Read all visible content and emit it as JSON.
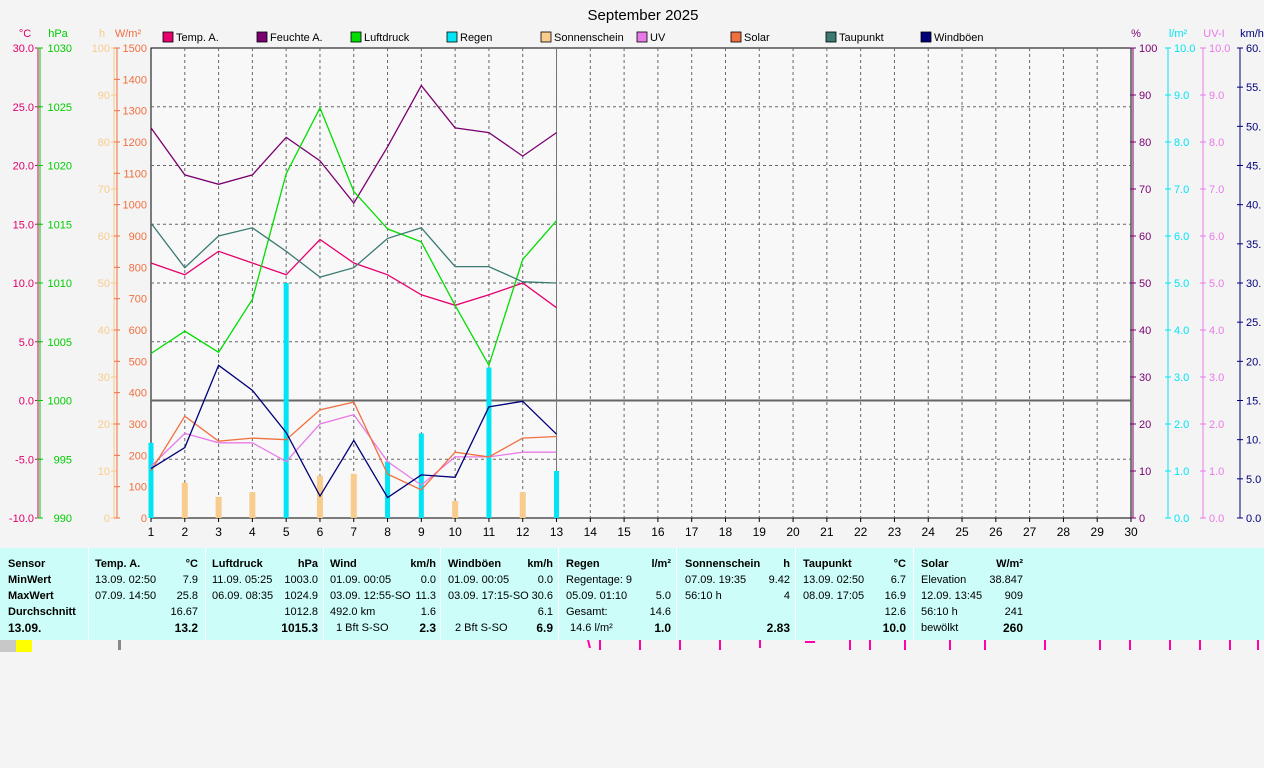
{
  "chart_data": {
    "type": "line",
    "title": "September 2025",
    "x": [
      1,
      2,
      3,
      4,
      5,
      6,
      7,
      8,
      9,
      10,
      11,
      12,
      13
    ],
    "x_ticks": [
      1,
      2,
      3,
      4,
      5,
      6,
      7,
      8,
      9,
      10,
      11,
      12,
      13,
      14,
      15,
      16,
      17,
      18,
      19,
      20,
      21,
      22,
      23,
      24,
      25,
      26,
      27,
      28,
      29,
      30
    ],
    "xlim": [
      1,
      30
    ],
    "legend": [
      "Temp. A.",
      "Feuchte A.",
      "Luftdruck",
      "Regen",
      "Sonnenschein",
      "UV",
      "Solar",
      "Taupunkt",
      "Windböen"
    ],
    "axes": {
      "temp": {
        "unit": "°C",
        "ticks": [
          "30.0",
          "25.0",
          "20.0",
          "15.0",
          "10.0",
          "5.0",
          "0.0",
          "-5.0",
          "-10.0"
        ],
        "ylim": [
          -10,
          30
        ]
      },
      "pressure": {
        "unit": "hPa",
        "ticks": [
          "1030",
          "1025",
          "1020",
          "1015",
          "1010",
          "1005",
          "1000",
          "995",
          "990"
        ],
        "ylim": [
          990,
          1030
        ]
      },
      "sunshine": {
        "unit": "h",
        "ticks": [
          "100",
          "90",
          "80",
          "70",
          "60",
          "50",
          "40",
          "30",
          "20",
          "10",
          "0"
        ],
        "ylim": [
          0,
          100
        ]
      },
      "solar": {
        "unit": "W/m²",
        "ticks": [
          "1500",
          "1400",
          "1300",
          "1200",
          "1100",
          "1000",
          "900",
          "800",
          "700",
          "600",
          "500",
          "400",
          "300",
          "200",
          "100",
          "0"
        ],
        "ylim": [
          0,
          1500
        ]
      },
      "humidity": {
        "unit": "%",
        "ticks": [
          "100",
          "90",
          "80",
          "70",
          "60",
          "50",
          "40",
          "30",
          "20",
          "10",
          "0"
        ],
        "ylim": [
          0,
          100
        ]
      },
      "rain": {
        "unit": "l/m²",
        "ticks": [
          "10.0",
          "9.0",
          "8.0",
          "7.0",
          "6.0",
          "5.0",
          "4.0",
          "3.0",
          "2.0",
          "1.0",
          "0.0"
        ],
        "ylim": [
          0,
          10
        ]
      },
      "uv": {
        "unit": "UV-I",
        "ticks": [
          "10.0",
          "9.0",
          "8.0",
          "7.0",
          "6.0",
          "5.0",
          "4.0",
          "3.0",
          "2.0",
          "1.0",
          "0.0"
        ],
        "ylim": [
          0,
          10
        ]
      },
      "wind": {
        "unit": "km/h",
        "ticks": [
          "60.",
          "55.",
          "50.",
          "45.",
          "40.",
          "35.",
          "30.",
          "25.",
          "20.",
          "15.",
          "10.",
          "5.0",
          "0.0"
        ],
        "ylim": [
          0,
          60
        ]
      }
    },
    "series": [
      {
        "name": "Temp. A.",
        "axis": "temp",
        "color": "#e6006e",
        "values": [
          11.7,
          10.7,
          12.7,
          11.7,
          10.7,
          13.7,
          11.7,
          10.7,
          9.0,
          8.1,
          9.0,
          10.0,
          7.9
        ]
      },
      {
        "name": "Feuchte A.",
        "axis": "humidity",
        "color": "#7a0070",
        "values": [
          83,
          73,
          71,
          73,
          81,
          76,
          67,
          79,
          92,
          83,
          82,
          77,
          82
        ]
      },
      {
        "name": "Luftdruck",
        "axis": "pressure",
        "color": "#00dd00",
        "values": [
          1004.0,
          1005.9,
          1004.1,
          1008.6,
          1019.3,
          1024.9,
          1017.8,
          1014.6,
          1013.5,
          1008.1,
          1003.0,
          1012.0,
          1015.3
        ]
      },
      {
        "name": "Regen",
        "axis": "rain",
        "color": "#00e5f5",
        "type": "bar",
        "values": [
          1.6,
          0,
          0,
          0.2,
          5.0,
          0.2,
          0,
          1.2,
          1.8,
          0,
          3.2,
          0.4,
          1.0
        ]
      },
      {
        "name": "Sonnenschein",
        "axis": "sunshine",
        "color": "#f8cc8c",
        "type": "bar",
        "values": [
          0,
          7.5,
          4.5,
          5.5,
          0,
          9.0,
          9.4,
          0,
          0,
          3.6,
          0,
          5.5,
          0
        ]
      },
      {
        "name": "UV",
        "axis": "uv",
        "color": "#e87ae8",
        "values": [
          1.1,
          1.8,
          1.6,
          1.6,
          1.2,
          2.0,
          2.2,
          1.2,
          0.7,
          1.3,
          1.3,
          1.4,
          1.4
        ]
      },
      {
        "name": "Solar",
        "axis": "solar",
        "color": "#f07040",
        "values": [
          150,
          325,
          245,
          255,
          250,
          345,
          370,
          140,
          90,
          210,
          195,
          255,
          260
        ]
      },
      {
        "name": "Taupunkt",
        "axis": "temp",
        "color": "#3a7a72",
        "values": [
          15.1,
          11.3,
          14.0,
          14.7,
          12.7,
          10.5,
          11.3,
          13.8,
          14.7,
          11.4,
          11.4,
          10.1,
          10.0
        ]
      },
      {
        "name": "Windböen",
        "axis": "wind",
        "color": "#00007a",
        "values": [
          6.3,
          9.0,
          19.5,
          16.3,
          10.9,
          2.8,
          9.9,
          2.6,
          5.5,
          5.2,
          14.2,
          14.9,
          10.7
        ]
      }
    ]
  },
  "summary": {
    "sensor": {
      "header": "Sensor",
      "min": "MinWert",
      "max": "MaxWert",
      "avg": "Durchschnitt",
      "date": "13.09."
    },
    "temp": {
      "title": "Temp. A.",
      "unit": "°C",
      "min_t": "13.09.  02:50",
      "min_v": "7.9",
      "max_t": "07.09.  14:50",
      "max_v": "25.8",
      "avg_v": "16.67",
      "cur_v": "13.2"
    },
    "pressure": {
      "title": "Luftdruck",
      "unit": "hPa",
      "min_t": "11.09.  05:25",
      "min_v": "1003.0",
      "max_t": "06.09.  08:35",
      "max_v": "1024.9",
      "avg_v": "1012.8",
      "cur_v": "1015.3"
    },
    "wind": {
      "title": "Wind",
      "unit": "km/h",
      "min_t": "01.09.  00:05",
      "min_v": "0.0",
      "max_t": "03.09.  12:55-SO",
      "max_v": "11.3",
      "avg_t": "492.0 km",
      "avg_v": "1.6",
      "cur_t": "1 Bft S-SO",
      "cur_v": "2.3"
    },
    "gust": {
      "title": "Windböen",
      "unit": "km/h",
      "min_t": "01.09.  00:05",
      "min_v": "0.0",
      "max_t": "03.09.  17:15-SO",
      "max_v": "30.6",
      "avg_v": "6.1",
      "cur_t": "2 Bft S-SO",
      "cur_v": "6.9"
    },
    "rain": {
      "title": "Regen",
      "unit": "l/m²",
      "row1": "Regentage: 9",
      "max_t": "05.09.  01:10",
      "max_v": "5.0",
      "avg_t": "Gesamt:",
      "avg_v": "14.6",
      "cur_t": "14.6 l/m²",
      "cur_v": "1.0"
    },
    "sun": {
      "title": "Sonnenschein",
      "unit": "h",
      "max_t": "07.09.  19:35",
      "max_v": "9.42",
      "avg_t": "56:10 h",
      "avg_v": "4",
      "cur_v": "2.83"
    },
    "dew": {
      "title": "Taupunkt",
      "unit": "°C",
      "min_t": "13.09.  02:50",
      "min_v": "6.7",
      "max_t": "08.09.  17:05",
      "max_v": "16.9",
      "avg_v": "12.6",
      "cur_v": "10.0"
    },
    "solar": {
      "title": "Solar",
      "unit": "W/m²",
      "min_t": "Elevation",
      "min_v": "38.847",
      "max_t": "12.09.  13:45",
      "max_v": "909",
      "avg_t": "56:10 h",
      "avg_v": "241",
      "cur_t": "bewölkt",
      "cur_v": "260"
    }
  }
}
